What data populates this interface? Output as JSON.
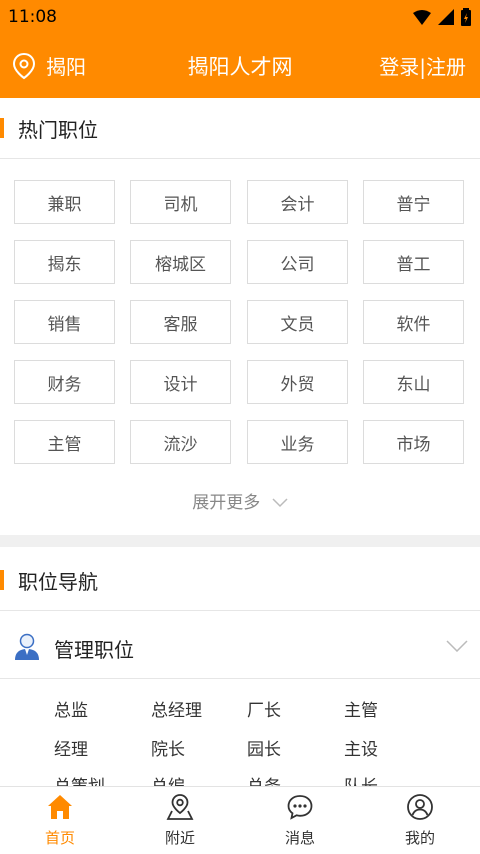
{
  "status_bar": {
    "time": "11:08"
  },
  "app_bar": {
    "location": "揭阳",
    "title": "揭阳人才网",
    "auth": "登录|注册"
  },
  "hot_jobs": {
    "title": "热门职位",
    "tags": [
      "兼职",
      "司机",
      "会计",
      "普宁",
      "揭东",
      "榕城区",
      "公司",
      "普工",
      "销售",
      "客服",
      "文员",
      "软件",
      "财务",
      "设计",
      "外贸",
      "东山",
      "主管",
      "流沙",
      "业务",
      "市场"
    ],
    "expand_label": "展开更多"
  },
  "job_nav": {
    "title": "职位导航",
    "category": {
      "label": "管理职位",
      "items": [
        "总监",
        "总经理",
        "厂长",
        "主管",
        "经理",
        "院长",
        "园长",
        "主设",
        "总策划",
        "总编",
        "总务",
        "队长"
      ]
    }
  },
  "bottom_nav": {
    "items": [
      {
        "label": "首页",
        "icon": "home-icon",
        "active": true
      },
      {
        "label": "附近",
        "icon": "nearby-map-icon",
        "active": false
      },
      {
        "label": "消息",
        "icon": "message-icon",
        "active": false
      },
      {
        "label": "我的",
        "icon": "profile-icon",
        "active": false
      }
    ]
  },
  "colors": {
    "accent": "#ff8a00",
    "text": "#222222",
    "border": "#dcdcdc"
  }
}
